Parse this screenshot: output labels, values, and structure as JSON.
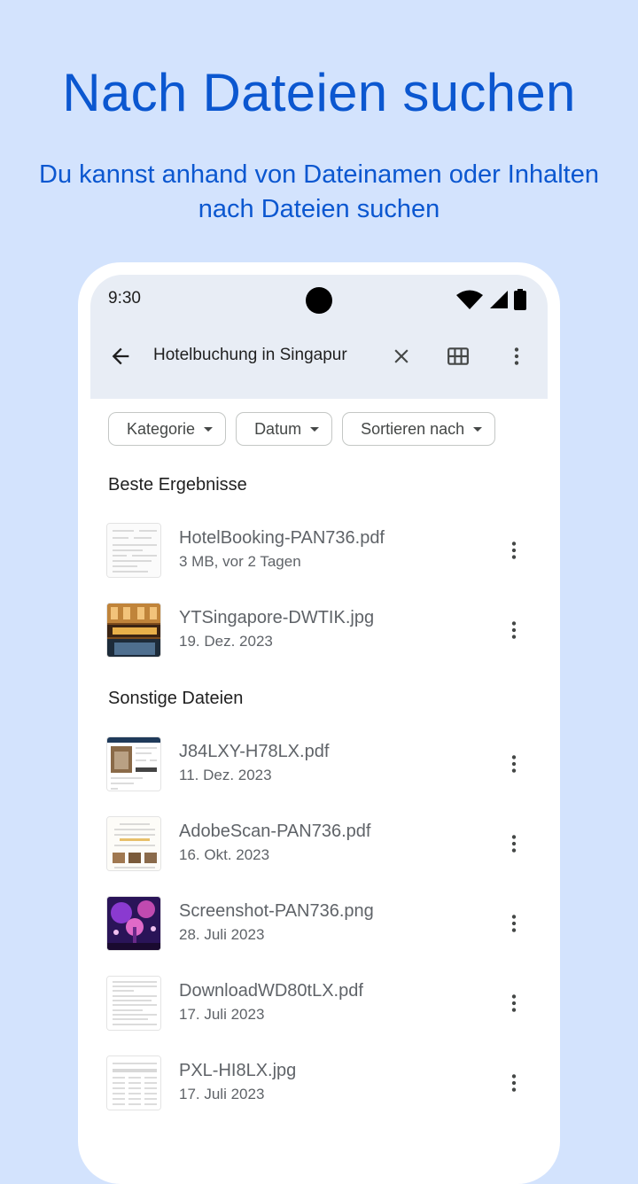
{
  "promo": {
    "title": "Nach Dateien suchen",
    "subtitle": "Du kannst anhand von Dateinamen oder Inhalten nach Dateien suchen"
  },
  "status_bar": {
    "time": "9:30",
    "icons": [
      "wifi-icon",
      "signal-icon",
      "battery-icon"
    ]
  },
  "search_bar": {
    "query": "Hotelbuchung in Singapur",
    "icons": [
      "arrow-back-icon",
      "close-icon",
      "grid-view-icon",
      "more-vert-icon"
    ]
  },
  "filters": [
    {
      "label": "Kategorie"
    },
    {
      "label": "Datum"
    },
    {
      "label": "Sortieren nach"
    }
  ],
  "best_results": {
    "heading": "Beste Ergebnisse",
    "files": [
      {
        "name": "HotelBooking-PAN736.pdf",
        "meta": "3 MB, vor 2 Tagen",
        "thumb": "document"
      },
      {
        "name": "YTSingapore-DWTIK.jpg",
        "meta": "19. Dez. 2023",
        "thumb": "hotel-photo"
      }
    ]
  },
  "other_files": {
    "heading": "Sonstige Dateien",
    "files": [
      {
        "name": "J84LXY-H78LX.pdf",
        "meta": "11. Dez. 2023",
        "thumb": "booking-page"
      },
      {
        "name": "AdobeScan-PAN736.pdf",
        "meta": "16. Okt. 2023",
        "thumb": "scan"
      },
      {
        "name": "Screenshot-PAN736.png",
        "meta": "28. Juli 2023",
        "thumb": "night-photo"
      },
      {
        "name": "DownloadWD80tLX.pdf",
        "meta": "17. Juli 2023",
        "thumb": "document"
      },
      {
        "name": "PXL-HI8LX.jpg",
        "meta": "17. Juli 2023",
        "thumb": "table-doc"
      }
    ]
  },
  "colors": {
    "accent": "#0b57d0",
    "background": "#d3e3fd",
    "topbar": "#e8edf5"
  }
}
